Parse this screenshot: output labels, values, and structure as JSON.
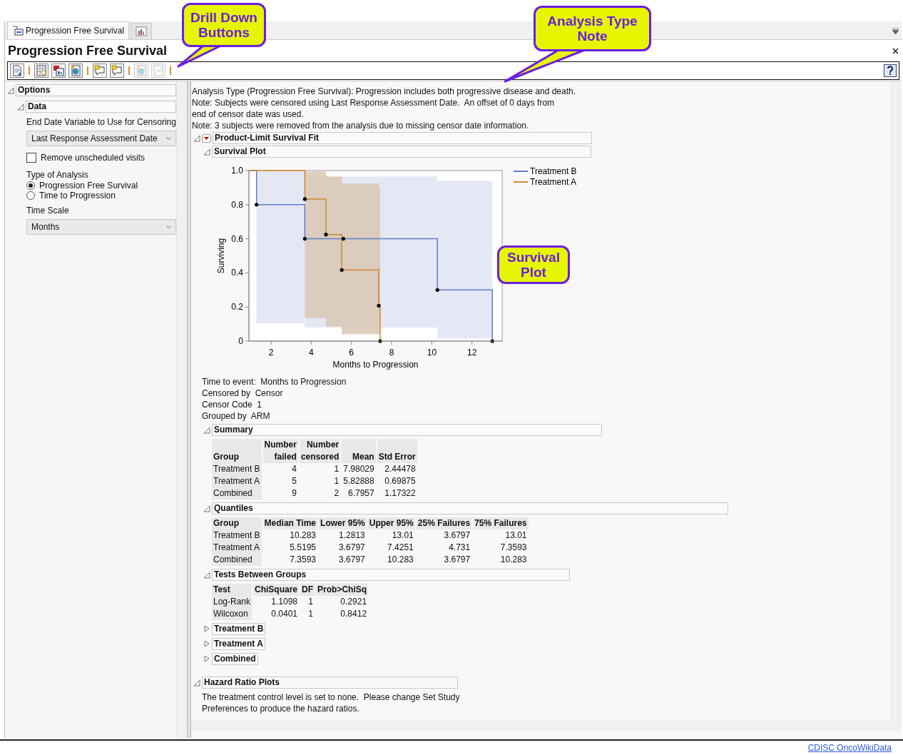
{
  "tabs": [
    {
      "kind": "report",
      "label": "Progression Free Survival",
      "selected": true
    },
    {
      "kind": "chart",
      "selected": false
    }
  ],
  "title": "Progression Free Survival",
  "toolbar": [
    {
      "kind": "document",
      "disabled": false
    },
    {
      "kind": "separator"
    },
    {
      "kind": "table",
      "disabled": false
    },
    {
      "kind": "window",
      "disabled": false
    },
    {
      "kind": "globe",
      "disabled": false
    },
    {
      "kind": "separator"
    },
    {
      "kind": "comment",
      "disabled": false
    },
    {
      "kind": "comment",
      "disabled": false
    },
    {
      "kind": "separator"
    },
    {
      "kind": "globe",
      "disabled": true
    },
    {
      "kind": "chart",
      "disabled": true
    },
    {
      "kind": "separator"
    }
  ],
  "options": {
    "title": "Options",
    "expanded": true,
    "data": {
      "title": "Data",
      "expanded": true,
      "censor_label": "End Date Variable to Use for Censoring",
      "censor_value": "Last Response Assessment Date",
      "remove_unscheduled": {
        "label": "Remove unscheduled visits",
        "checked": false
      },
      "analysis_label": "Type of Analysis",
      "analysis_options": [
        {
          "label": "Progression Free Survival",
          "selected": true
        },
        {
          "label": "Time to Progression",
          "selected": false
        }
      ],
      "time_scale_label": "Time Scale",
      "time_scale_value": "Months"
    }
  },
  "notes": [
    "Analysis Type (Progression Free Survival): Progression includes both progressive disease and death.",
    "Note: Subjects were censored using Last Response Assessment Date.  An offset of 0 days from end of censor date was used.",
    "Note: 3 subjects were removed from the analysis due to missing censor date information."
  ],
  "fit": {
    "title": "Product-Limit Survival Fit",
    "expanded": true,
    "plot": {
      "title": "Survival Plot",
      "expanded": true,
      "chart_data": {
        "type": "line",
        "xlabel": "Months to Progression",
        "ylabel": "Surviving",
        "xlim": [
          0.9,
          13.5
        ],
        "ylim": [
          0,
          1
        ],
        "legend": true,
        "xticks": [
          2,
          4,
          6,
          8,
          10,
          12
        ],
        "yticks": [
          {
            "value": 0,
            "label": "0"
          },
          {
            "value": 0.2,
            "label": "0.2"
          },
          {
            "value": 0.4,
            "label": "0.4"
          },
          {
            "value": 0.6,
            "label": "0.6"
          },
          {
            "value": 0.8,
            "label": "0.8"
          },
          {
            "value": 1,
            "label": "1.0"
          }
        ],
        "series": [
          {
            "name": "Treatment B",
            "color": "#5b7fc8",
            "x": [
              0.9,
              1.28,
              1.28,
              3.68,
              3.68,
              5.6,
              10.28,
              10.28,
              13.01,
              13.01
            ],
            "values": [
              1,
              1,
              0.8,
              0.8,
              0.6,
              0.6,
              0.6,
              0.3,
              0.3,
              0
            ]
          },
          {
            "name": "Treatment A",
            "color": "#d0882c",
            "x": [
              0.9,
              3.68,
              3.68,
              4.73,
              4.73,
              5.52,
              5.52,
              7.36,
              7.36,
              7.43,
              7.43
            ],
            "values": [
              1,
              1,
              0.833,
              0.833,
              0.625,
              0.625,
              0.417,
              0.417,
              0.208,
              0.208,
              0
            ]
          }
        ],
        "bands": [
          {
            "axis": "x",
            "color": "#dfe4f3",
            "from": 1.28,
            "to": 3.68
          },
          {
            "axis": "x",
            "color": "#dfe4f3",
            "from": 3.68,
            "to": 10.28
          },
          {
            "axis": "x",
            "color": "#dfe4f3",
            "from": 10.28,
            "to": 13.01
          },
          {
            "axis": "x",
            "color": "#d9c7b4",
            "from": 3.68,
            "to": 4.73
          },
          {
            "axis": "x",
            "color": "#d9c7b4",
            "from": 4.73,
            "to": 5.52
          },
          {
            "axis": "x",
            "color": "#d9c7b4",
            "from": 5.52,
            "to": 7.36
          },
          {
            "axis": "x",
            "color": "#d9c7b4",
            "from": 7.36,
            "to": 7.43
          }
        ]
      }
    },
    "info": [
      "Time to event:  Months to Progression",
      "Censored by  Censor",
      "Censor Code  1",
      "Grouped by  ARM"
    ],
    "summary": {
      "title": "Summary",
      "expanded": true,
      "columns": [
        "Group",
        "Number\nfailed",
        "Number\ncensored",
        "Mean",
        "Std Error"
      ],
      "rows": [
        [
          "Treatment B",
          "4",
          "1",
          "7.98029",
          "2.44478"
        ],
        [
          "Treatment A",
          "5",
          "1",
          "5.82888",
          "0.69875"
        ],
        [
          "Combined",
          "9",
          "2",
          "6.7957",
          "1.17322"
        ]
      ]
    },
    "quantiles": {
      "title": "Quantiles",
      "expanded": true,
      "columns": [
        "Group",
        "Median Time",
        "Lower 95%",
        "Upper 95%",
        "25% Failures",
        "75% Failures"
      ],
      "rows": [
        [
          "Treatment B",
          "10.283",
          "1.2813",
          "13.01",
          "3.6797",
          "13.01"
        ],
        [
          "Treatment A",
          "5.5195",
          "3.6797",
          "7.4251",
          "4.731",
          "7.3593"
        ],
        [
          "Combined",
          "7.3593",
          "3.6797",
          "10.283",
          "3.6797",
          "10.283"
        ]
      ]
    },
    "tests": {
      "title": "Tests Between Groups",
      "expanded": true,
      "columns": [
        "Test",
        "ChiSquare",
        "DF",
        "Prob>ChiSq"
      ],
      "rows": [
        [
          "Log-Rank",
          "1.1098",
          "1",
          "0.2921"
        ],
        [
          "Wilcoxon",
          "0.0401",
          "1",
          "0.8412"
        ]
      ]
    },
    "groups": [
      {
        "title": "Treatment B",
        "expanded": false
      },
      {
        "title": "Treatment A",
        "expanded": false
      },
      {
        "title": "Combined",
        "expanded": false
      }
    ]
  },
  "hazard": {
    "title": "Hazard Ratio Plots",
    "expanded": true,
    "text": "The treatment control level is set to none.  Please change Set Study Preferences to produce the hazard ratios."
  },
  "footer_link": "CDISC OncoWikiData",
  "callouts": [
    {
      "text": "Drill Down Buttons",
      "pointer": true
    },
    {
      "text": "Analysis Type Note",
      "pointer": true
    },
    {
      "text": "Survival Plot",
      "pointer": false
    }
  ]
}
